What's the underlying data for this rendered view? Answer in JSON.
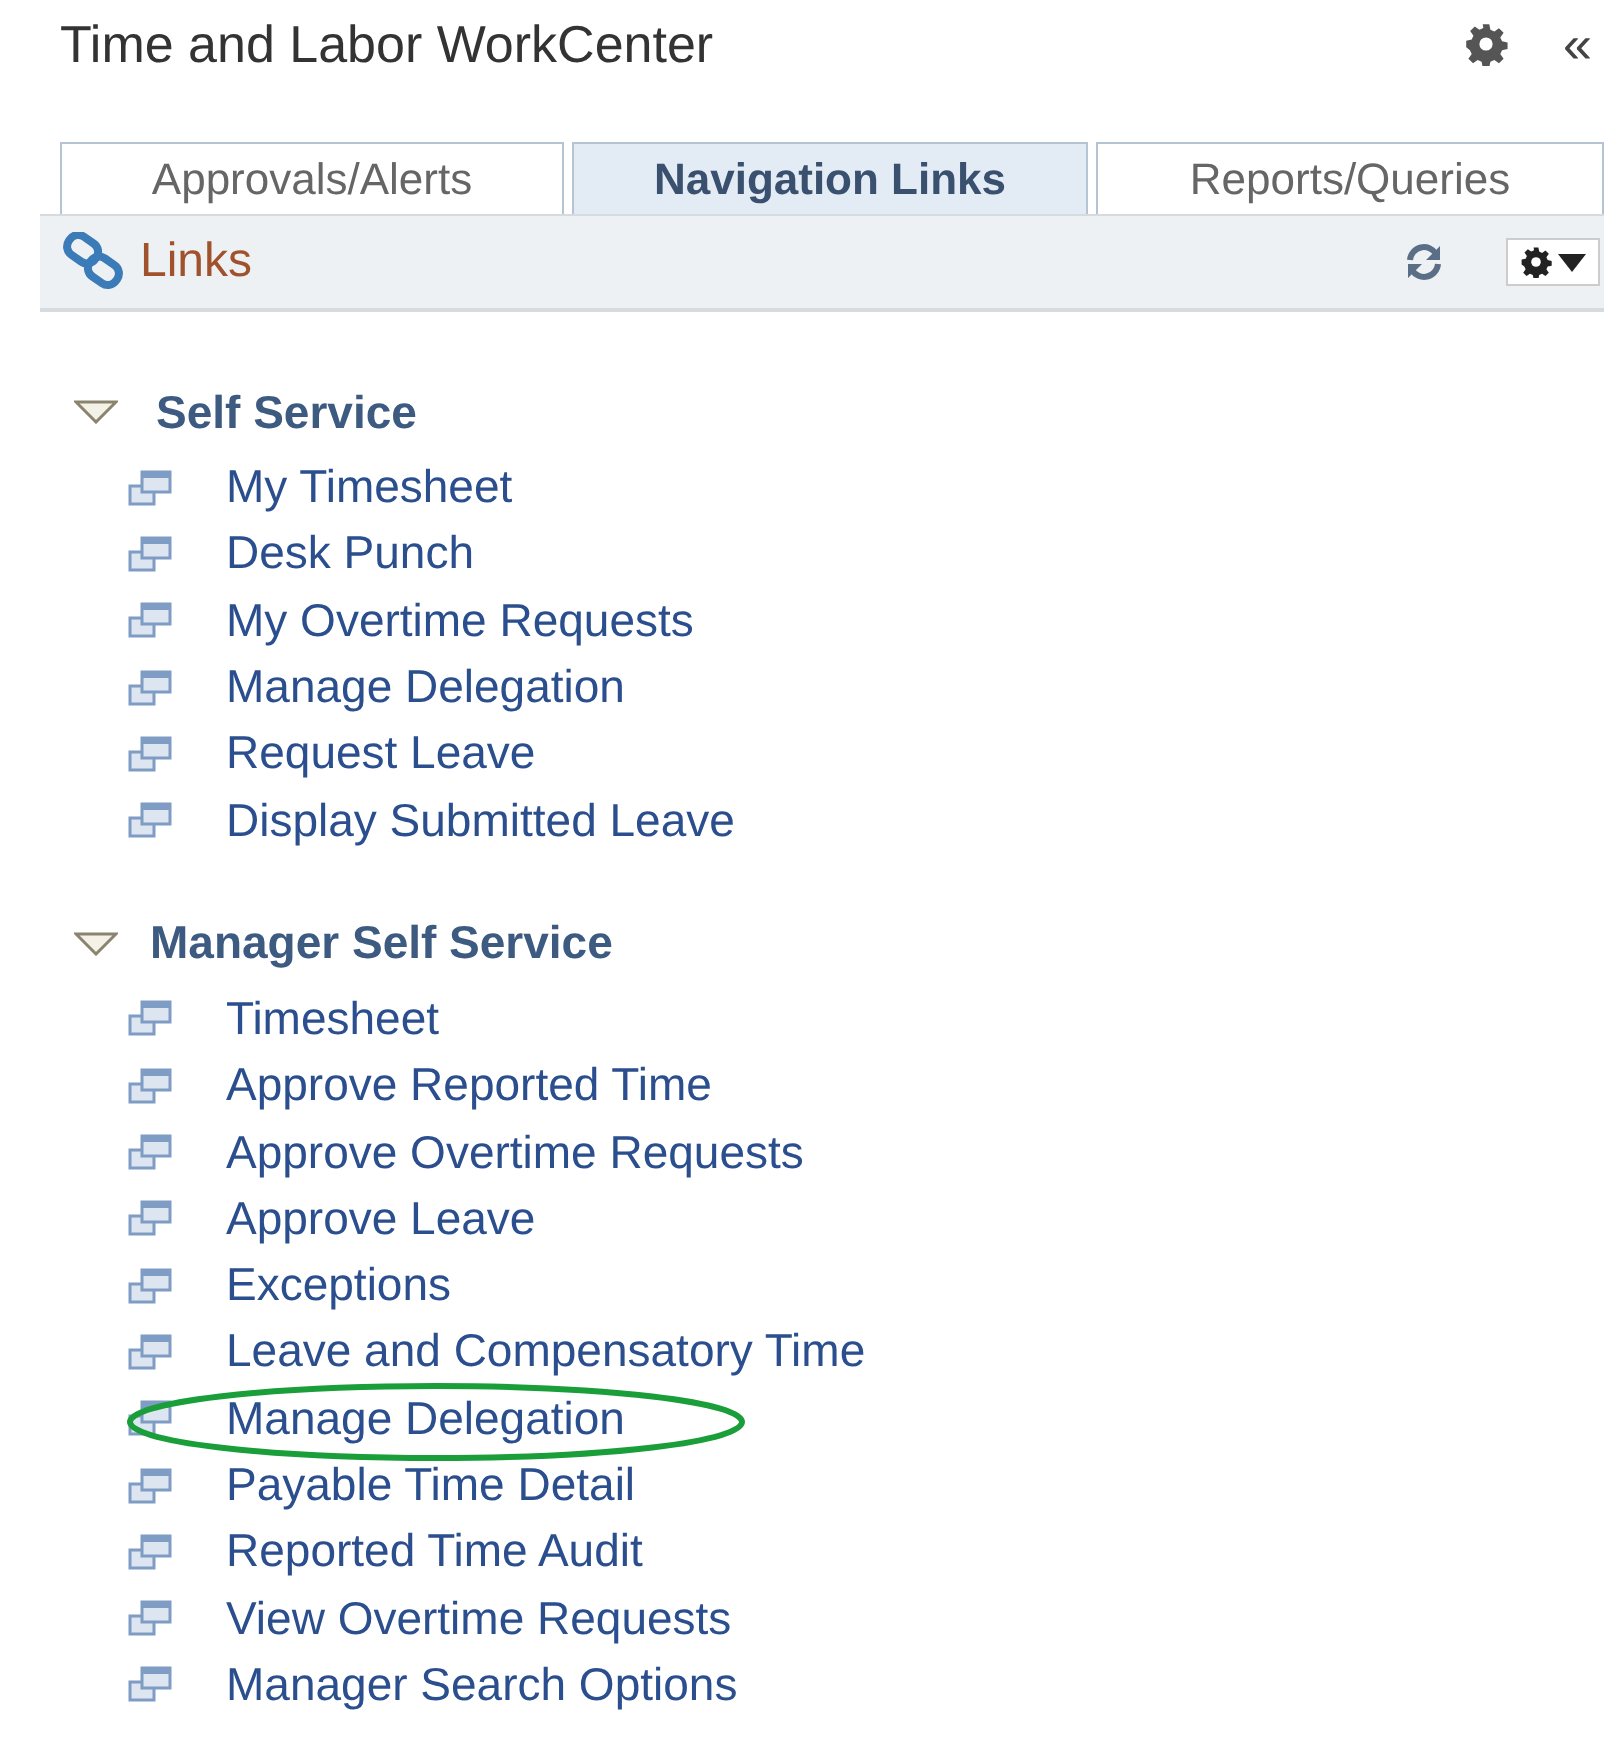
{
  "header": {
    "title": "Time and Labor WorkCenter",
    "collapse": "«"
  },
  "tabs": [
    {
      "label": "Approvals/Alerts",
      "selected": false
    },
    {
      "label": "Navigation Links",
      "selected": true
    },
    {
      "label": "Reports/Queries",
      "selected": false
    }
  ],
  "pagelet": {
    "title": "Links"
  },
  "groups": [
    {
      "title": "Self Service",
      "expanded": true,
      "items": [
        {
          "label": "My Timesheet",
          "highlighted": false
        },
        {
          "label": "Desk Punch",
          "highlighted": false
        },
        {
          "label": "My Overtime Requests",
          "highlighted": false
        },
        {
          "label": "Manage Delegation",
          "highlighted": false
        },
        {
          "label": "Request Leave",
          "highlighted": false
        },
        {
          "label": "Display Submitted Leave",
          "highlighted": false
        }
      ]
    },
    {
      "title": "Manager Self Service",
      "expanded": true,
      "items": [
        {
          "label": "Timesheet",
          "highlighted": false
        },
        {
          "label": "Approve Reported Time",
          "highlighted": false
        },
        {
          "label": "Approve Overtime Requests",
          "highlighted": false
        },
        {
          "label": "Approve Leave",
          "highlighted": false
        },
        {
          "label": "Exceptions",
          "highlighted": false
        },
        {
          "label": "Leave and Compensatory Time",
          "highlighted": false
        },
        {
          "label": "Manage Delegation",
          "highlighted": true
        },
        {
          "label": "Payable Time Detail",
          "highlighted": false
        },
        {
          "label": "Reported Time Audit",
          "highlighted": false
        },
        {
          "label": "View Overtime Requests",
          "highlighted": false
        },
        {
          "label": "Manager Search Options",
          "highlighted": false
        }
      ]
    }
  ]
}
